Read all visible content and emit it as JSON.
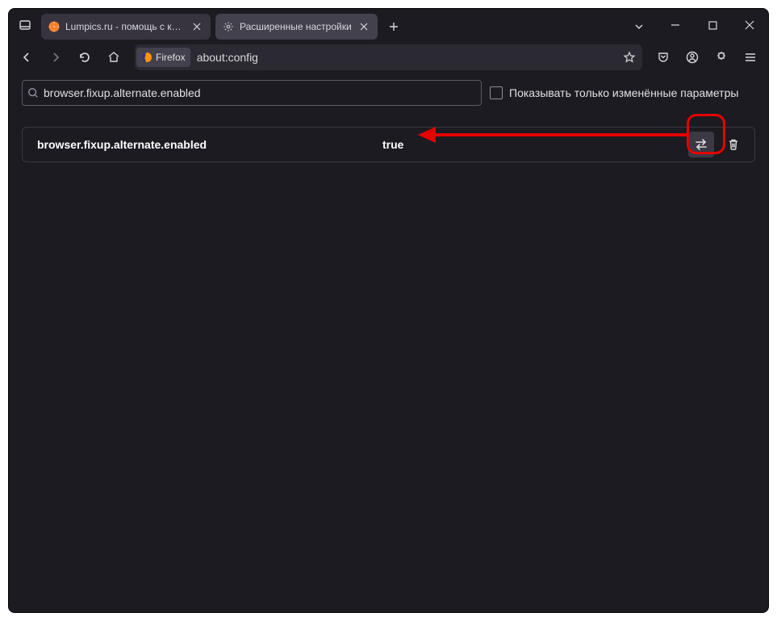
{
  "titlebar": {
    "tabs": [
      {
        "label": "Lumpics.ru - помощь с компь",
        "active": false
      },
      {
        "label": "Расширенные настройки",
        "active": true
      }
    ]
  },
  "toolbar": {
    "firefox_badge": "Firefox",
    "url": "about:config"
  },
  "config": {
    "search_value": "browser.fixup.alternate.enabled",
    "only_modified_label": "Показывать только изменённые параметры",
    "pref": {
      "name": "browser.fixup.alternate.enabled",
      "value": "true"
    }
  }
}
